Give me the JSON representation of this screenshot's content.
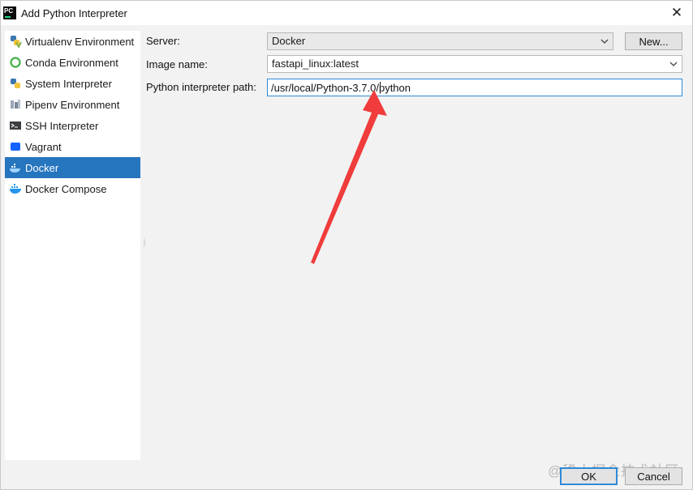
{
  "window": {
    "title": "Add Python Interpreter",
    "app_icon_text": "PC"
  },
  "sidebar": {
    "items": [
      {
        "label": "Virtualenv Environment",
        "icon": "virtualenv-icon"
      },
      {
        "label": "Conda Environment",
        "icon": "conda-icon"
      },
      {
        "label": "System Interpreter",
        "icon": "python-icon"
      },
      {
        "label": "Pipenv Environment",
        "icon": "pipenv-icon"
      },
      {
        "label": "SSH Interpreter",
        "icon": "terminal-icon"
      },
      {
        "label": "Vagrant",
        "icon": "vagrant-icon"
      },
      {
        "label": "Docker",
        "icon": "docker-icon",
        "selected": true
      },
      {
        "label": "Docker Compose",
        "icon": "docker-compose-icon"
      }
    ]
  },
  "form": {
    "server_label": "Server:",
    "server_value": "Docker",
    "new_button": "New...",
    "image_label": "Image name:",
    "image_value": "fastapi_linux:latest",
    "path_label": "Python interpreter path:",
    "path_value": "/usr/local/Python-3.7.0/python"
  },
  "footer": {
    "ok": "OK",
    "cancel": "Cancel",
    "watermark": "@稀土掘金技术社区"
  },
  "colors": {
    "selection": "#2675bf",
    "focus_border": "#2e8ad8",
    "annotation_arrow": "#f03c3c"
  }
}
